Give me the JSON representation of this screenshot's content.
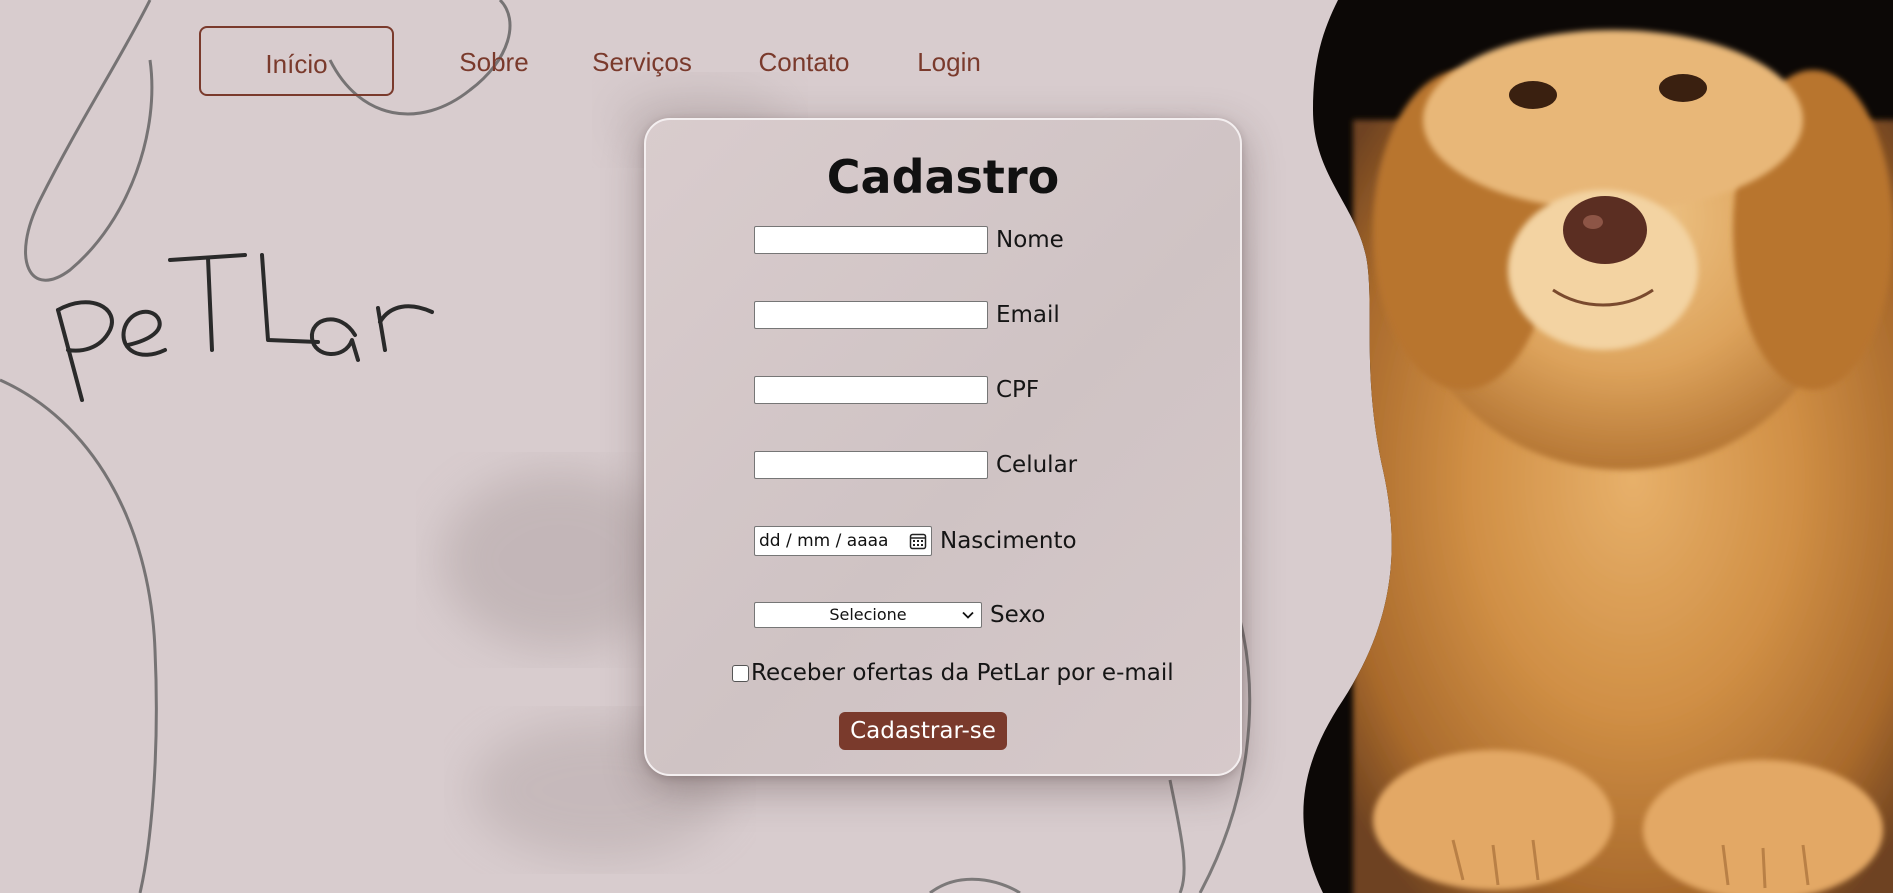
{
  "nav": {
    "items": [
      {
        "label": "Início",
        "active": true
      },
      {
        "label": "Sobre",
        "active": false
      },
      {
        "label": "Serviços",
        "active": false
      },
      {
        "label": "Contato",
        "active": false
      },
      {
        "label": "Login",
        "active": false
      }
    ]
  },
  "brand": {
    "logo_text": "PeTLar"
  },
  "form": {
    "title": "Cadastro",
    "fields": {
      "nome": {
        "label": "Nome",
        "value": ""
      },
      "email": {
        "label": "Email",
        "value": ""
      },
      "cpf": {
        "label": "CPF",
        "value": ""
      },
      "celular": {
        "label": "Celular",
        "value": ""
      },
      "nascimento": {
        "label": "Nascimento",
        "placeholder": "dd / mm / aaaa"
      },
      "sexo": {
        "label": "Sexo",
        "selected": "Selecione"
      }
    },
    "newsletter_label": "Receber ofertas da PetLar por e-mail",
    "newsletter_checked": false,
    "submit_label": "Cadastrar-se"
  },
  "colors": {
    "accent": "#7a3a2c",
    "background": "#d8ccce",
    "card": "#d3c7c8"
  },
  "hero_image": {
    "subject": "golden-retriever"
  }
}
